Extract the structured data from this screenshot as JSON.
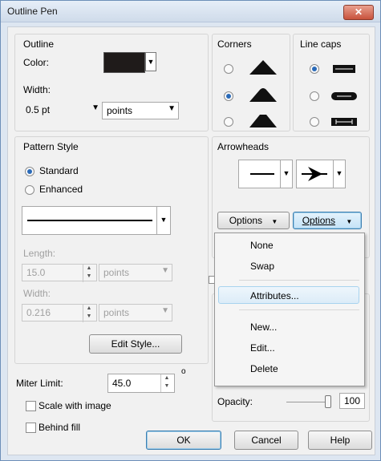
{
  "window": {
    "title": "Outline Pen",
    "close_glyph": "✕"
  },
  "outline": {
    "group_label": "Outline",
    "color_label": "Color:",
    "color_value": "#1f1b1a",
    "width_label": "Width:",
    "width_value": "0.5 pt",
    "width_units": "points"
  },
  "corners": {
    "label": "Corners",
    "selected_index": 1
  },
  "line_caps": {
    "label": "Line caps",
    "selected_index": 0
  },
  "pattern": {
    "group_label": "Pattern Style",
    "standard_label": "Standard",
    "enhanced_label": "Enhanced",
    "selected": "Standard",
    "length_label": "Length:",
    "length_value": "15.0",
    "length_units": "points",
    "width_label": "Width:",
    "width_value": "0.216",
    "width_units": "points",
    "edit_style_label": "Edit Style..."
  },
  "arrowheads": {
    "label": "Arrowheads",
    "options_left": "Options",
    "options_right": "Options"
  },
  "menu": {
    "items": [
      "None",
      "Swap",
      "Attributes...",
      "New...",
      "Edit...",
      "Delete"
    ],
    "highlighted": "Attributes..."
  },
  "miter": {
    "label": "Miter Limit:",
    "value": "45.0",
    "unit": "o"
  },
  "scale_label": "Scale with image",
  "behind_fill_label": "Behind fill",
  "opacity": {
    "label": "Opacity:",
    "value": "100"
  },
  "buttons": {
    "ok": "OK",
    "cancel": "Cancel",
    "help": "Help"
  }
}
